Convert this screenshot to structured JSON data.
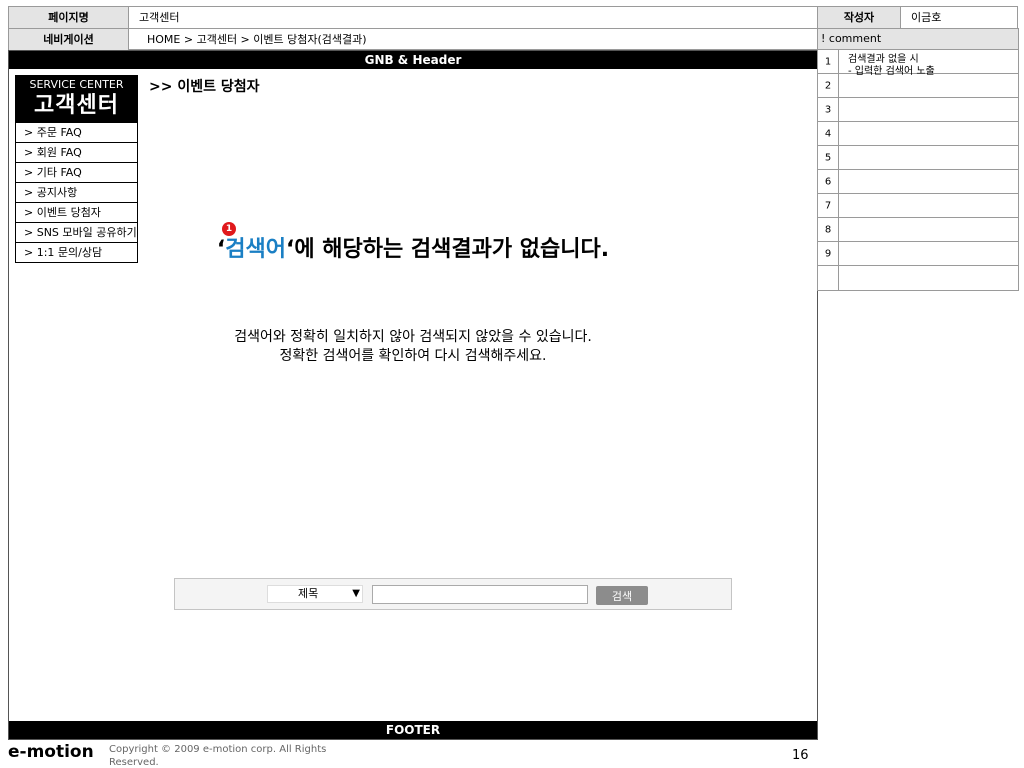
{
  "spec": {
    "page_name_label": "페이지명",
    "page_name": "고객센터",
    "navigation_label": "네비게이션",
    "navigation": "HOME > 고객센터 > 이벤트 당첨자(검색결과)",
    "author_label": "작성자",
    "author": "이금호"
  },
  "gnb": "GNB & Header",
  "sidebar": {
    "title_en": "SERVICE CENTER",
    "title_ko": "고객센터",
    "items": [
      {
        "label": "> 주문 FAQ"
      },
      {
        "label": "> 회원 FAQ"
      },
      {
        "label": "> 기타 FAQ"
      },
      {
        "label": "> 공지사항"
      },
      {
        "label": "> 이벤트 당첨자"
      },
      {
        "label": "> SNS 모바일 공유하기"
      },
      {
        "label": "> 1:1 문의/상담"
      }
    ]
  },
  "main": {
    "heading": ">> 이벤트 당첨자",
    "no_result": {
      "quote_open": "‘",
      "keyword": "검색어",
      "rest": "‘에 해당하는 검색결과가 없습니다."
    },
    "marker": "1",
    "guide_line1": "검색어와 정확히 일치하지 않아 검색되지 않았을 수 있습니다.",
    "guide_line2": "정확한 검색어를 확인하여 다시 검색해주세요."
  },
  "search": {
    "select_value": "제목",
    "input_value": "",
    "button": "검색"
  },
  "footer": "FOOTER",
  "comment": {
    "header": "! comment",
    "rows": [
      {
        "num": "1",
        "text": "검색결과 없을 시\n- 입력한 검색어 노출"
      },
      {
        "num": "2",
        "text": ""
      },
      {
        "num": "3",
        "text": ""
      },
      {
        "num": "4",
        "text": ""
      },
      {
        "num": "5",
        "text": ""
      },
      {
        "num": "6",
        "text": ""
      },
      {
        "num": "7",
        "text": ""
      },
      {
        "num": "8",
        "text": ""
      },
      {
        "num": "9",
        "text": ""
      },
      {
        "num": "",
        "text": ""
      }
    ]
  },
  "bottom": {
    "logo": "e-motion",
    "copyright": "Copyright © 2009 e-motion corp. All Rights Reserved.",
    "page_number": "16"
  }
}
